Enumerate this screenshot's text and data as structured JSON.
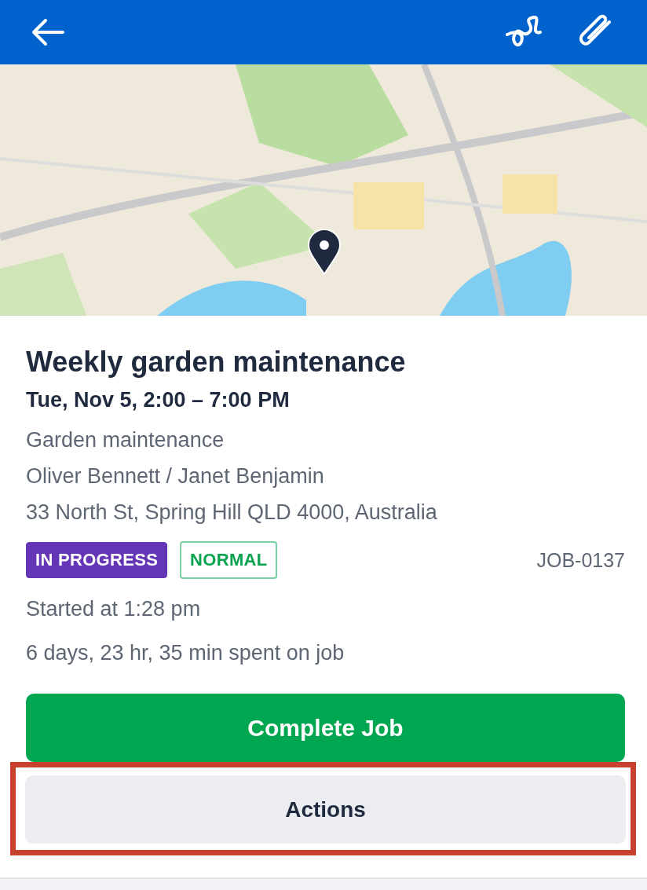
{
  "job": {
    "title": "Weekly garden maintenance",
    "schedule": "Tue, Nov 5, 2:00 – 7:00 PM",
    "details": [
      "Garden maintenance",
      "Oliver Bennett / Janet Benjamin",
      "33 North St, Spring Hill QLD 4000, Australia"
    ],
    "badges": [
      {
        "label": "IN PROGRESS",
        "kind": "filled",
        "color": "#6435b5"
      },
      {
        "label": "NORMAL",
        "kind": "outline",
        "color": "#0aa350"
      }
    ],
    "number": "JOB-0137",
    "started": "Started at 1:28 pm",
    "duration": "6 days, 23 hr, 35 min spent on job"
  },
  "buttons": [
    {
      "label": "Complete Job",
      "kind": "primary",
      "highlighted": false
    },
    {
      "label": "Actions",
      "kind": "secondary",
      "highlighted": true
    }
  ]
}
